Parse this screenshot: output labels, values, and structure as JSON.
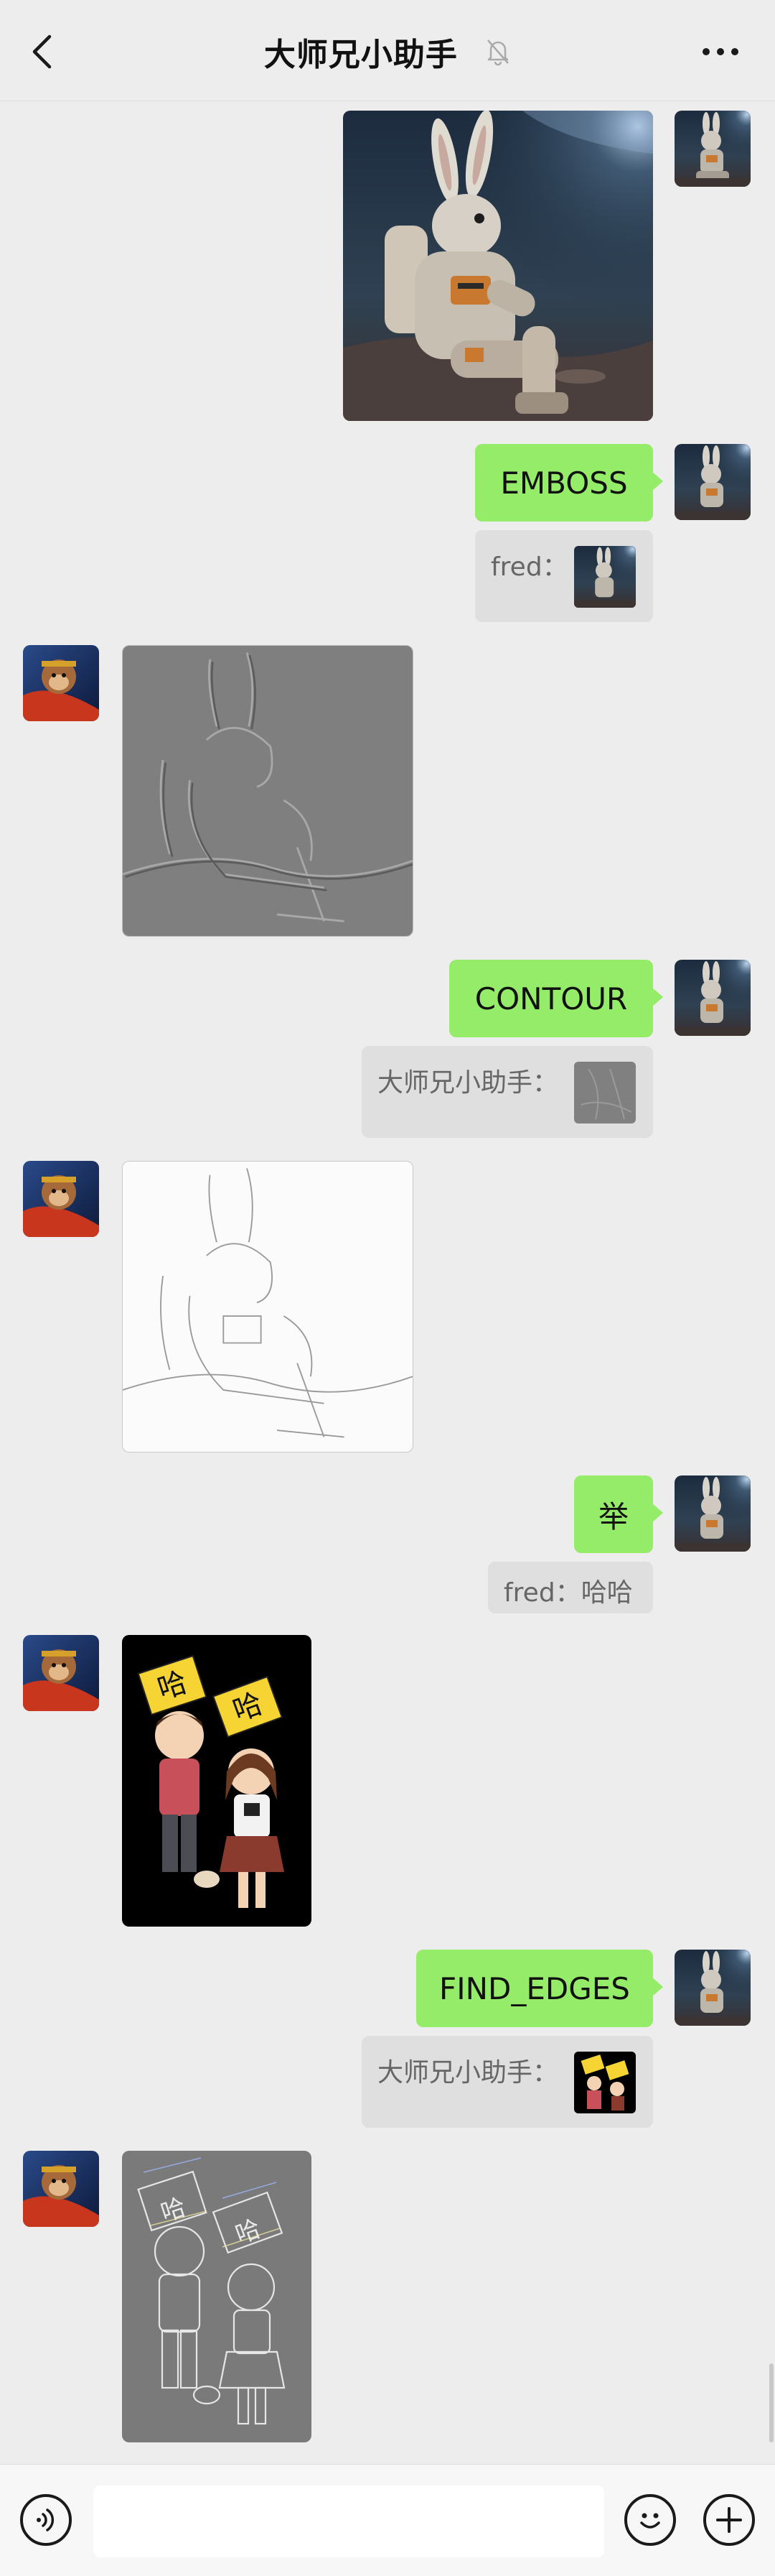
{
  "header": {
    "title": "大师兄小助手",
    "back_icon": "chevron-left-icon",
    "mute_icon": "bell-off-icon",
    "more_icon": "more-dots-icon"
  },
  "messages": [
    {
      "type": "image",
      "sender": "self",
      "content": "astronaut-rabbit-photo"
    },
    {
      "type": "text",
      "sender": "self",
      "text": "EMBOSS"
    },
    {
      "type": "quote",
      "sender": "self",
      "quote_label": "fred：",
      "quote_content": "astronaut-rabbit-thumbnail"
    },
    {
      "type": "image",
      "sender": "other",
      "content": "embossed-rabbit-image"
    },
    {
      "type": "text",
      "sender": "self",
      "text": "CONTOUR"
    },
    {
      "type": "quote",
      "sender": "self",
      "quote_label": "大师兄小助手：",
      "quote_content": "embossed-rabbit-thumbnail"
    },
    {
      "type": "image",
      "sender": "other",
      "content": "contour-rabbit-image"
    },
    {
      "type": "text",
      "sender": "self",
      "text": "举"
    },
    {
      "type": "quote",
      "sender": "self",
      "quote_label": "fred：",
      "quote_text": "哈哈"
    },
    {
      "type": "image",
      "sender": "other",
      "content": "haha-cartoon-couple-image",
      "sign_text": "哈"
    },
    {
      "type": "text",
      "sender": "self",
      "text": "FIND_EDGES"
    },
    {
      "type": "quote",
      "sender": "self",
      "quote_label": "大师兄小助手：",
      "quote_content": "haha-cartoon-thumbnail"
    },
    {
      "type": "image",
      "sender": "other",
      "content": "find-edges-cartoon-image",
      "sign_text": "哈"
    }
  ],
  "input_bar": {
    "voice_icon": "voice-icon",
    "emoji_icon": "emoji-icon",
    "add_icon": "plus-icon",
    "input_value": ""
  },
  "colors": {
    "background": "#ededed",
    "self_bubble": "#95ec69",
    "quote_bg": "#dfdfdf"
  }
}
